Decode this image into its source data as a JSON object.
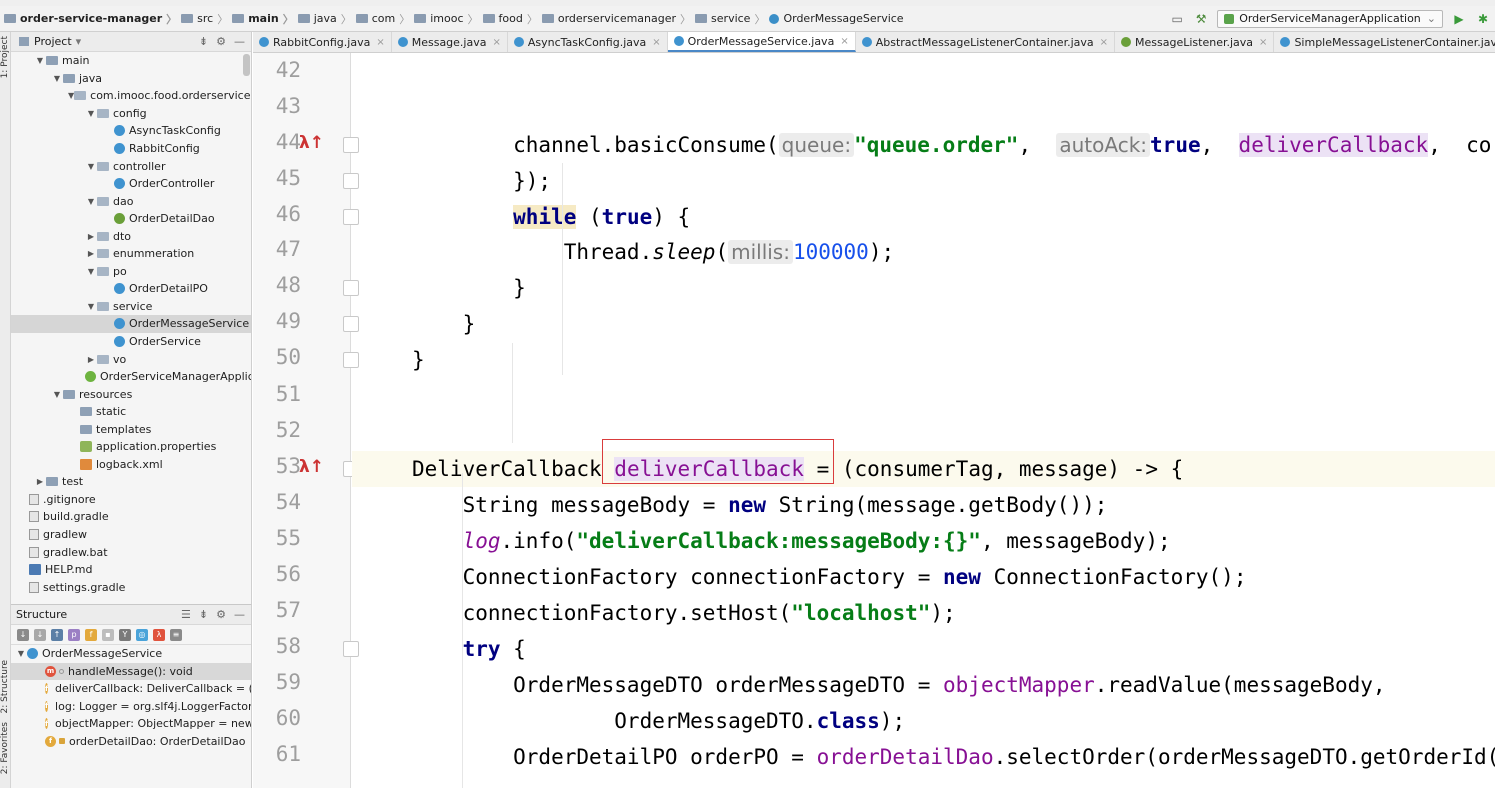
{
  "nav": {
    "project": "order-service-manager",
    "crumbs": [
      "src",
      "main",
      "java",
      "com",
      "imooc",
      "food",
      "orderservicemanager",
      "service",
      "OrderMessageService"
    ],
    "run_config": "OrderServiceManagerApplication"
  },
  "side_labels": {
    "project": "1: Project",
    "structure": "2: Structure",
    "favorites": "2: Favorites"
  },
  "project_panel": {
    "title": "Project",
    "items": [
      {
        "label": "main",
        "icon": "folder",
        "depth": 1,
        "expanded": true
      },
      {
        "label": "java",
        "icon": "folder",
        "depth": 2,
        "expanded": true
      },
      {
        "label": "com.imooc.food.orderservicemanager",
        "icon": "pkg",
        "depth": 3,
        "expanded": true
      },
      {
        "label": "config",
        "icon": "pkg",
        "depth": 4,
        "expanded": true
      },
      {
        "label": "AsyncTaskConfig",
        "icon": "cls",
        "depth": 5
      },
      {
        "label": "RabbitConfig",
        "icon": "cls",
        "depth": 5
      },
      {
        "label": "controller",
        "icon": "pkg",
        "depth": 4,
        "expanded": true
      },
      {
        "label": "OrderController",
        "icon": "cls",
        "depth": 5
      },
      {
        "label": "dao",
        "icon": "pkg",
        "depth": 4,
        "expanded": true
      },
      {
        "label": "OrderDetailDao",
        "icon": "iface",
        "depth": 5
      },
      {
        "label": "dto",
        "icon": "pkg",
        "depth": 4,
        "expanded": false
      },
      {
        "label": "enummeration",
        "icon": "pkg",
        "depth": 4,
        "expanded": false
      },
      {
        "label": "po",
        "icon": "pkg",
        "depth": 4,
        "expanded": true
      },
      {
        "label": "OrderDetailPO",
        "icon": "cls",
        "depth": 5
      },
      {
        "label": "service",
        "icon": "pkg",
        "depth": 4,
        "expanded": true
      },
      {
        "label": "OrderMessageService",
        "icon": "cls",
        "depth": 5,
        "selected": true
      },
      {
        "label": "OrderService",
        "icon": "cls",
        "depth": 5
      },
      {
        "label": "vo",
        "icon": "pkg",
        "depth": 4,
        "expanded": false
      },
      {
        "label": "OrderServiceManagerApplication",
        "icon": "spring",
        "depth": 4
      },
      {
        "label": "resources",
        "icon": "folder",
        "depth": 2,
        "expanded": true
      },
      {
        "label": "static",
        "icon": "folder",
        "depth": 3
      },
      {
        "label": "templates",
        "icon": "folder",
        "depth": 3
      },
      {
        "label": "application.properties",
        "icon": "prop",
        "depth": 3
      },
      {
        "label": "logback.xml",
        "icon": "xml",
        "depth": 3
      },
      {
        "label": "test",
        "icon": "folder",
        "depth": 1,
        "expanded": false
      },
      {
        "label": ".gitignore",
        "icon": "file",
        "depth": 0
      },
      {
        "label": "build.gradle",
        "icon": "file",
        "depth": 0
      },
      {
        "label": "gradlew",
        "icon": "file",
        "depth": 0
      },
      {
        "label": "gradlew.bat",
        "icon": "file",
        "depth": 0
      },
      {
        "label": "HELP.md",
        "icon": "md",
        "depth": 0
      },
      {
        "label": "settings.gradle",
        "icon": "file",
        "depth": 0
      }
    ]
  },
  "structure_panel": {
    "title": "Structure",
    "root": "OrderMessageService",
    "members": [
      {
        "badge": "m",
        "label": "handleMessage(): void",
        "selected": true
      },
      {
        "badge": "f",
        "label": "deliverCallback: DeliverCallback = (c"
      },
      {
        "badge": "f",
        "label": "log: Logger = org.slf4j.LoggerFactor"
      },
      {
        "badge": "f",
        "label": "objectMapper: ObjectMapper = new"
      },
      {
        "badge": "f",
        "label": "orderDetailDao: OrderDetailDao"
      }
    ]
  },
  "tabs": [
    {
      "label": "RabbitConfig.java",
      "icon": "cls"
    },
    {
      "label": "Message.java",
      "icon": "cls"
    },
    {
      "label": "AsyncTaskConfig.java",
      "icon": "cls"
    },
    {
      "label": "OrderMessageService.java",
      "icon": "cls",
      "active": true
    },
    {
      "label": "AbstractMessageListenerContainer.java",
      "icon": "cls"
    },
    {
      "label": "MessageListener.java",
      "icon": "iface"
    },
    {
      "label": "SimpleMessageListenerContainer.java",
      "icon": "cls"
    }
  ],
  "editor": {
    "line_numbers": [
      "42",
      "43",
      "44",
      "45",
      "46",
      "47",
      "48",
      "49",
      "50",
      "51",
      "52",
      "53",
      "54",
      "55",
      "56",
      "57",
      "58",
      "59",
      "60",
      "61"
    ],
    "lines": [
      [],
      [],
      [
        {
          "t": "        channel.basicConsume("
        },
        {
          "t": "queue:",
          "c": "hint"
        },
        {
          "t": "\"queue.order\"",
          "c": "str"
        },
        {
          "t": ",  "
        },
        {
          "t": "autoAck:",
          "c": "hint"
        },
        {
          "t": "true",
          "c": "kw"
        },
        {
          "t": ",  "
        },
        {
          "t": "deliverCallback",
          "c": "field hl-ident"
        },
        {
          "t": ",  co"
        }
      ],
      [
        {
          "t": "        });"
        }
      ],
      [
        {
          "t": "        "
        },
        {
          "t": "while",
          "c": "kw hl-whilekw"
        },
        {
          "t": " ("
        },
        {
          "t": "true",
          "c": "kw"
        },
        {
          "t": ") {"
        }
      ],
      [
        {
          "t": "            Thread."
        },
        {
          "t": "sleep",
          "c": "italic"
        },
        {
          "t": "("
        },
        {
          "t": "millis:",
          "c": "hint"
        },
        {
          "t": "100000",
          "c": "num"
        },
        {
          "t": ");"
        }
      ],
      [
        {
          "t": "        }"
        }
      ],
      [
        {
          "t": "    }"
        }
      ],
      [
        {
          "t": "}"
        }
      ],
      [],
      [],
      [
        {
          "t": "DeliverCallback "
        },
        {
          "t": "deliverCallback",
          "c": "field hl-ident"
        },
        {
          "t": " = (consumerTag, message) -> {"
        }
      ],
      [
        {
          "t": "    String messageBody = "
        },
        {
          "t": "new",
          "c": "kw"
        },
        {
          "t": " String(message.getBody());"
        }
      ],
      [
        {
          "t": "    "
        },
        {
          "t": "log",
          "c": "field italic"
        },
        {
          "t": ".info("
        },
        {
          "t": "\"deliverCallback:messageBody:{}\"",
          "c": "str"
        },
        {
          "t": ", messageBody);"
        }
      ],
      [
        {
          "t": "    ConnectionFactory connectionFactory = "
        },
        {
          "t": "new",
          "c": "kw"
        },
        {
          "t": " ConnectionFactory();"
        }
      ],
      [
        {
          "t": "    connectionFactory.setHost("
        },
        {
          "t": "\"localhost\"",
          "c": "str"
        },
        {
          "t": ");"
        }
      ],
      [
        {
          "t": "    "
        },
        {
          "t": "try",
          "c": "kw"
        },
        {
          "t": " {"
        }
      ],
      [
        {
          "t": "        OrderMessageDTO orderMessageDTO = "
        },
        {
          "t": "objectMapper",
          "c": "field"
        },
        {
          "t": ".readValue(messageBody,"
        }
      ],
      [
        {
          "t": "                OrderMessageDTO."
        },
        {
          "t": "class",
          "c": "kw"
        },
        {
          "t": ");"
        }
      ],
      [
        {
          "t": "        OrderDetailPO orderPO = "
        },
        {
          "t": "orderDetailDao",
          "c": "field"
        },
        {
          "t": ".selectOrder(orderMessageDTO.getOrderId("
        }
      ]
    ]
  },
  "colors": {
    "selection": "#d6d6d6",
    "accent": "#4a88c7",
    "annotation_box": "#d93c3c"
  }
}
